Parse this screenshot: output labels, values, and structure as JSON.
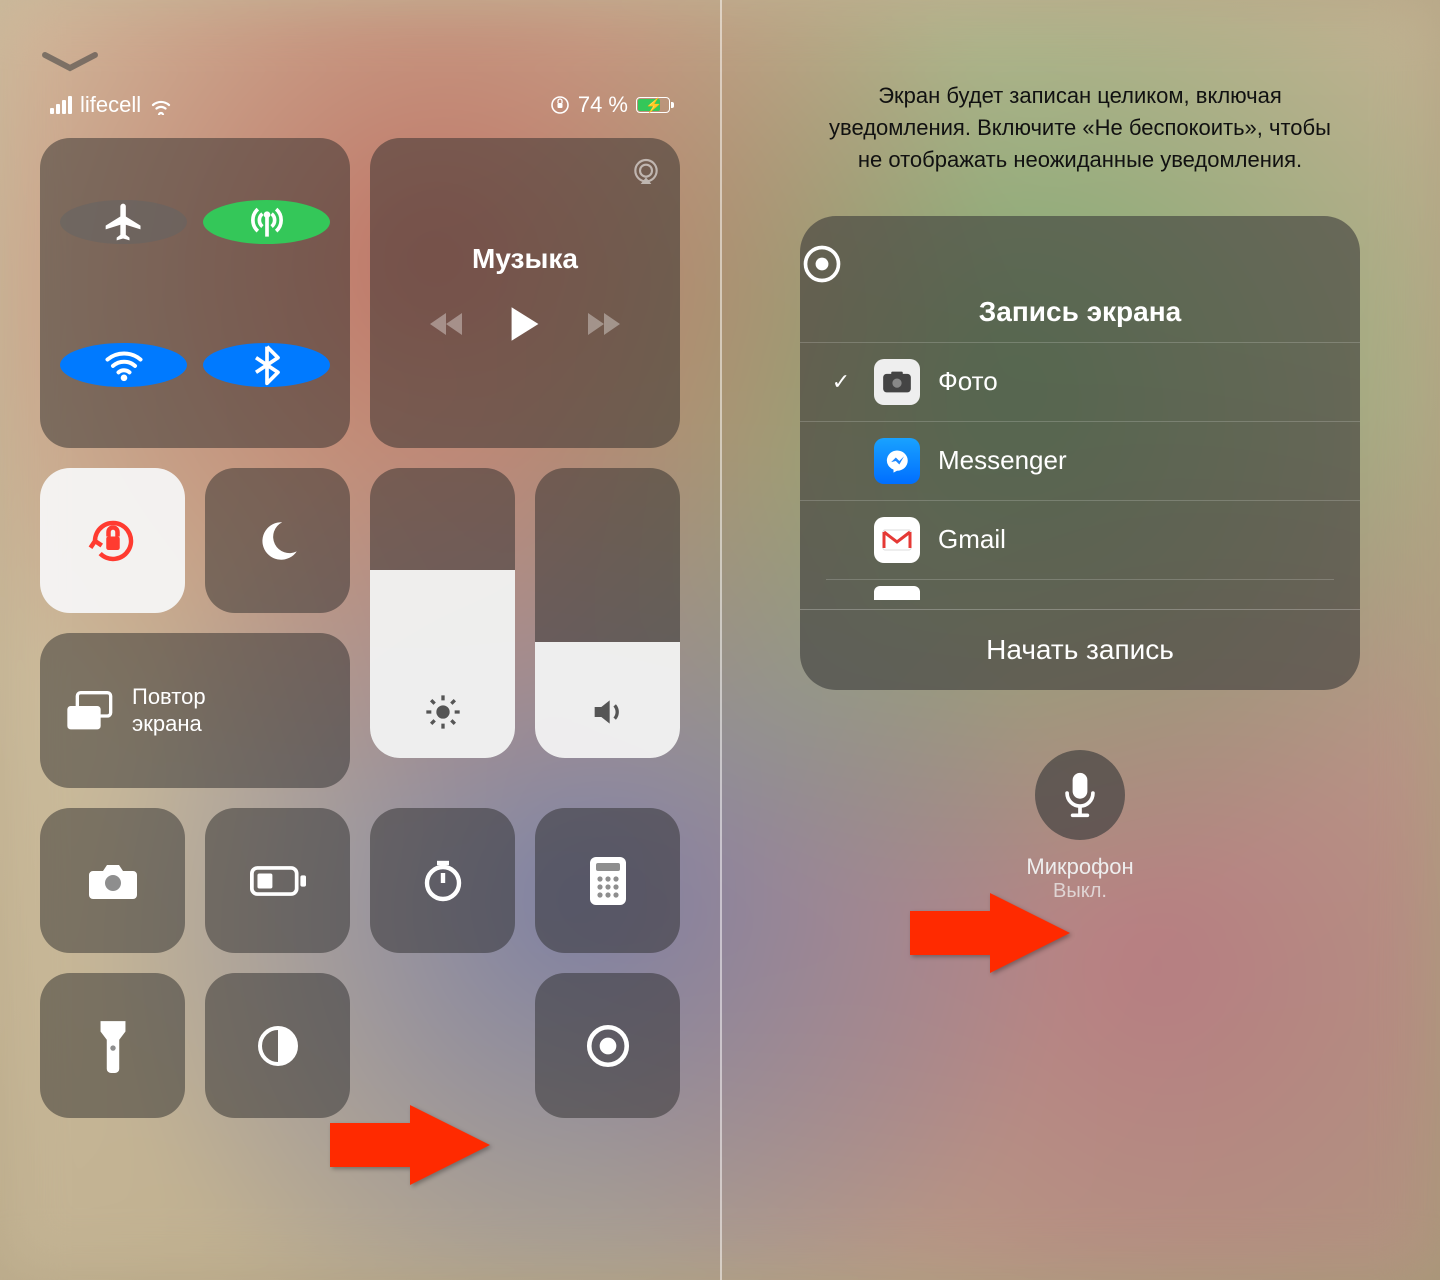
{
  "status": {
    "carrier": "lifecell",
    "battery_pct": "74 %"
  },
  "music": {
    "title": "Музыка"
  },
  "mirror": {
    "label": "Повтор\nэкрана"
  },
  "sliders": {
    "brightness_pct": 65,
    "volume_pct": 40
  },
  "recording": {
    "notice": "Экран будет записан целиком, включая уведомления. Включите «Не беспокоить», чтобы не отображать неожиданные уведомления.",
    "title": "Запись экрана",
    "destinations": [
      {
        "label": "Фото",
        "selected": true
      },
      {
        "label": "Messenger",
        "selected": false
      },
      {
        "label": "Gmail",
        "selected": false
      }
    ],
    "start": "Начать запись",
    "mic_label": "Микрофон",
    "mic_state": "Выкл."
  }
}
